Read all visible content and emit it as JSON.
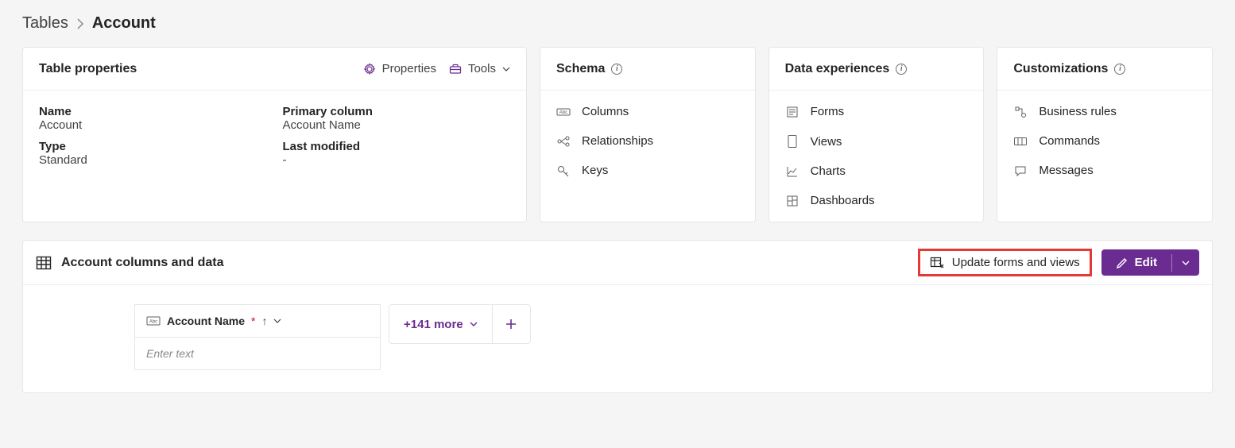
{
  "breadcrumb": {
    "root": "Tables",
    "current": "Account"
  },
  "properties_card": {
    "title": "Table properties",
    "actions": {
      "properties": "Properties",
      "tools": "Tools"
    },
    "fields": {
      "name_label": "Name",
      "name_value": "Account",
      "type_label": "Type",
      "type_value": "Standard",
      "primary_label": "Primary column",
      "primary_value": "Account Name",
      "modified_label": "Last modified",
      "modified_value": "-"
    }
  },
  "schema_card": {
    "title": "Schema",
    "items": {
      "columns": "Columns",
      "relationships": "Relationships",
      "keys": "Keys"
    }
  },
  "data_exp_card": {
    "title": "Data experiences",
    "items": {
      "forms": "Forms",
      "views": "Views",
      "charts": "Charts",
      "dashboards": "Dashboards"
    }
  },
  "custom_card": {
    "title": "Customizations",
    "items": {
      "business_rules": "Business rules",
      "commands": "Commands",
      "messages": "Messages"
    }
  },
  "data_section": {
    "title": "Account columns and data",
    "update_label": "Update forms and views",
    "edit_label": "Edit",
    "column_header": "Account Name",
    "more_label": "+141 more",
    "placeholder": "Enter text"
  }
}
